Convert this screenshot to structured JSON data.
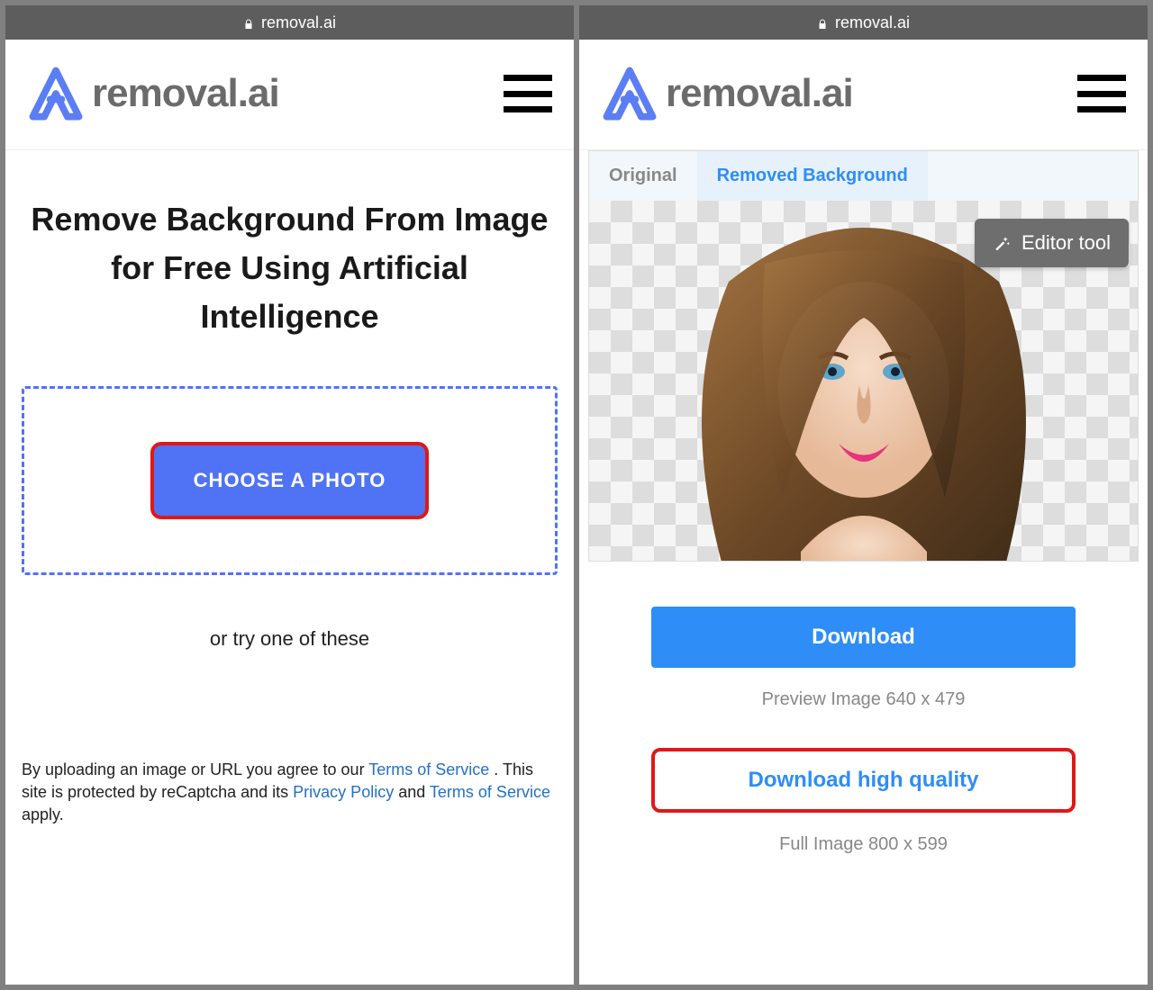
{
  "url": "removal.ai",
  "brand": "removal.ai",
  "left": {
    "headline": "Remove Background From Image for Free Using Artificial Intelligence",
    "choose_button": "CHOOSE A PHOTO",
    "try_text": "or try one of these",
    "legal_pre": "By uploading an image or URL you agree to our ",
    "tos": "Terms of Service",
    "legal_mid1": " . This site is protected by reCaptcha and its ",
    "privacy": "Privacy Policy",
    "legal_mid2": " and ",
    "tos2": "Terms of Service",
    "legal_end": " apply."
  },
  "right": {
    "tab_original": "Original",
    "tab_removed": "Removed Background",
    "editor_tool": "Editor tool",
    "download": "Download",
    "preview_label": "Preview Image   640 x 479",
    "download_hq": "Download high quality",
    "full_label": "Full Image   800 x 599"
  }
}
